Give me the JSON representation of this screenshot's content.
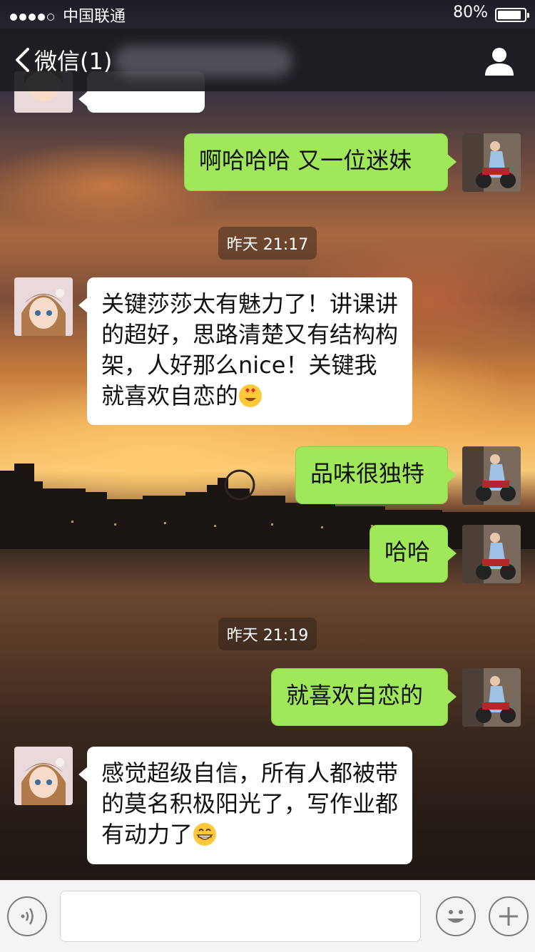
{
  "status_bar": {
    "carrier": "中国联通",
    "battery": "80%",
    "battery_level": 0.8
  },
  "nav": {
    "back_label": "微信(1)"
  },
  "messages": [
    {
      "side": "right",
      "text": "啊哈哈哈  又一位迷妹"
    },
    {
      "timestamp": "昨天 21:17"
    },
    {
      "side": "left",
      "text": "关键莎莎太有魅力了！讲课讲的超好，思路清楚又有结构构架，人好那么nice！关键我就喜欢自恋的",
      "emoji": "heart-eyes-emoji-icon"
    },
    {
      "side": "right",
      "text": "品味很独特"
    },
    {
      "side": "right",
      "text": "哈哈"
    },
    {
      "timestamp": "昨天 21:19"
    },
    {
      "side": "right",
      "text": "就喜欢自恋的"
    },
    {
      "side": "left",
      "text": "感觉超级自信，所有人都被带的莫名积极阳光了，写作业都有动力了",
      "emoji": "grin-emoji-icon"
    }
  ],
  "input": {
    "value": ""
  },
  "icons": {
    "back": "chevron-left-icon",
    "profile": "person-icon",
    "voice": "voice-icon",
    "emoji": "smiley-icon",
    "plus": "plus-icon"
  },
  "colors": {
    "green_bubble": "#a0e75a",
    "white_bubble": "#ffffff",
    "nav_bg": "#1c1c22"
  }
}
